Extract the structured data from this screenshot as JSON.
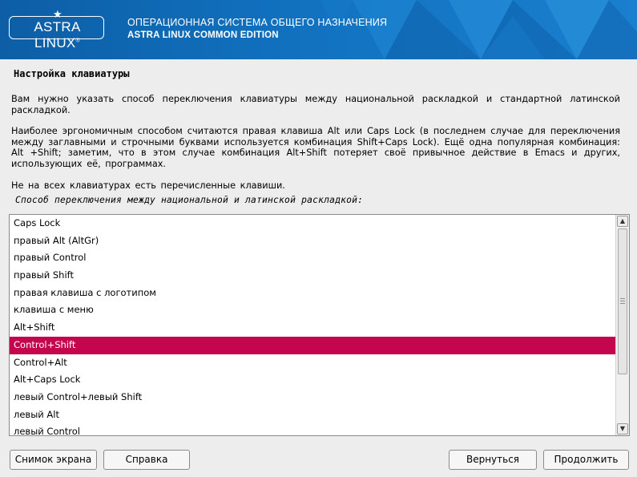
{
  "banner": {
    "logo_text": "ASTRA LINUX",
    "logo_reg": "®",
    "line1": "ОПЕРАЦИОННАЯ СИСТЕМА ОБЩЕГО НАЗНАЧЕНИЯ",
    "line2": "ASTRA LINUX COMMON EDITION",
    "colors": {
      "base": "#1171bf",
      "dark": "#0d5ea5"
    }
  },
  "page": {
    "title": "Настройка клавиатуры",
    "paragraph1": "Вам нужно указать способ переключения клавиатуры между национальной раскладкой и стандартной латинской раскладкой.",
    "paragraph2": "Наиболее эргономичным способом считаются правая клавиша Alt или Caps Lock (в последнем случае для переключения между заглавными и строчными буквами используется комбинация Shift+Caps Lock). Ещё одна популярная комбинация: Alt +Shift; заметим, что в этом случае комбинация Alt+Shift потеряет своё привычное действие в Emacs и других, использующих её, программах.",
    "paragraph3": "Не на всех клавиатурах есть перечисленные клавиши.",
    "prompt": "Способ переключения между национальной и латинской раскладкой:"
  },
  "list": {
    "items": [
      "Caps Lock",
      "правый Alt (AltGr)",
      "правый Control",
      "правый Shift",
      "правая клавиша с логотипом",
      "клавиша с меню",
      "Alt+Shift",
      "Control+Shift",
      "Control+Alt",
      "Alt+Caps Lock",
      "левый Control+левый Shift",
      "левый Alt",
      "левый Control"
    ],
    "selected": "Control+Shift",
    "selection_color": "#c4064f"
  },
  "buttons": {
    "screenshot": "Снимок экрана",
    "help": "Справка",
    "back": "Вернуться",
    "continue": "Продолжить"
  }
}
